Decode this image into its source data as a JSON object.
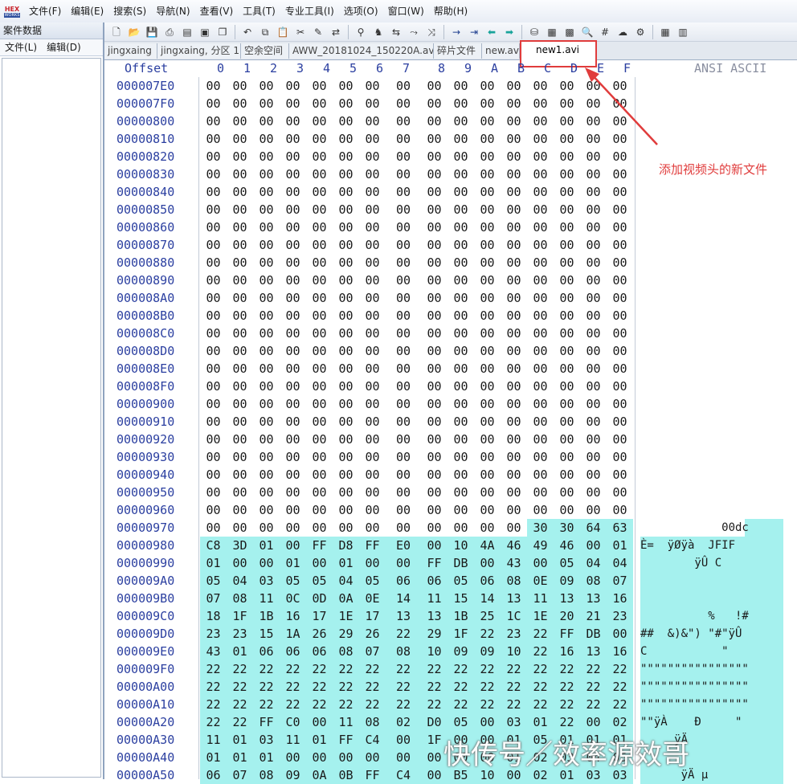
{
  "menu": [
    "文件(F)",
    "编辑(E)",
    "搜索(S)",
    "导航(N)",
    "查看(V)",
    "工具(T)",
    "专业工具(I)",
    "选项(O)",
    "窗口(W)",
    "帮助(H)"
  ],
  "logo_text": [
    "HEX",
    "WORKS"
  ],
  "left_panel": {
    "title": "案件数据",
    "menu": [
      "文件(L)",
      "编辑(D)"
    ]
  },
  "toolbar_icons": [
    [
      "new-file-icon",
      "open-file-icon",
      "save-icon",
      "print-icon",
      "properties-icon",
      "open-disk-icon",
      "clone-icon"
    ],
    [
      "undo-icon",
      "copy-icon",
      "paste-icon",
      "cut-icon",
      "write-icon",
      "convert-icon"
    ],
    [
      "find-icon",
      "find-hex-icon",
      "replace-icon",
      "find-next-icon",
      "replace-hex-icon"
    ],
    [
      "goto-icon",
      "goto-offset-icon",
      "back-arrow-icon",
      "forward-arrow-icon"
    ],
    [
      "disk-icon",
      "ram-icon",
      "calc-icon",
      "zoom-icon",
      "hash-icon",
      "cloud-icon",
      "gear-icon"
    ],
    [
      "tiles-icon",
      "windows-icon"
    ]
  ],
  "tabs": [
    {
      "label": "jingxaing",
      "active": false
    },
    {
      "label": "jingxaing, 分区 1",
      "active": false
    },
    {
      "label": "空余空间",
      "active": false
    },
    {
      "label": "AWW_20181024_150220A.avi",
      "active": false
    },
    {
      "label": "碎片文件",
      "active": false
    },
    {
      "label": "new.avi",
      "active": false
    },
    {
      "label": "new1.avi",
      "active": true
    }
  ],
  "header": {
    "offset_label": "Offset",
    "columns": [
      "0",
      "1",
      "2",
      "3",
      "4",
      "5",
      "6",
      "7",
      "8",
      "9",
      "A",
      "B",
      "C",
      "D",
      "E",
      "F"
    ],
    "ascii_label": "ANSI ASCII"
  },
  "rows": [
    {
      "offset": "000007E0",
      "bytes": [
        "00",
        "00",
        "00",
        "00",
        "00",
        "00",
        "00",
        "00",
        "00",
        "00",
        "00",
        "00",
        "00",
        "00",
        "00",
        "00"
      ],
      "ascii": ""
    },
    {
      "offset": "000007F0",
      "bytes": [
        "00",
        "00",
        "00",
        "00",
        "00",
        "00",
        "00",
        "00",
        "00",
        "00",
        "00",
        "00",
        "00",
        "00",
        "00",
        "00"
      ],
      "ascii": ""
    },
    {
      "offset": "00000800",
      "bytes": [
        "00",
        "00",
        "00",
        "00",
        "00",
        "00",
        "00",
        "00",
        "00",
        "00",
        "00",
        "00",
        "00",
        "00",
        "00",
        "00"
      ],
      "ascii": ""
    },
    {
      "offset": "00000810",
      "bytes": [
        "00",
        "00",
        "00",
        "00",
        "00",
        "00",
        "00",
        "00",
        "00",
        "00",
        "00",
        "00",
        "00",
        "00",
        "00",
        "00"
      ],
      "ascii": ""
    },
    {
      "offset": "00000820",
      "bytes": [
        "00",
        "00",
        "00",
        "00",
        "00",
        "00",
        "00",
        "00",
        "00",
        "00",
        "00",
        "00",
        "00",
        "00",
        "00",
        "00"
      ],
      "ascii": ""
    },
    {
      "offset": "00000830",
      "bytes": [
        "00",
        "00",
        "00",
        "00",
        "00",
        "00",
        "00",
        "00",
        "00",
        "00",
        "00",
        "00",
        "00",
        "00",
        "00",
        "00"
      ],
      "ascii": ""
    },
    {
      "offset": "00000840",
      "bytes": [
        "00",
        "00",
        "00",
        "00",
        "00",
        "00",
        "00",
        "00",
        "00",
        "00",
        "00",
        "00",
        "00",
        "00",
        "00",
        "00"
      ],
      "ascii": ""
    },
    {
      "offset": "00000850",
      "bytes": [
        "00",
        "00",
        "00",
        "00",
        "00",
        "00",
        "00",
        "00",
        "00",
        "00",
        "00",
        "00",
        "00",
        "00",
        "00",
        "00"
      ],
      "ascii": ""
    },
    {
      "offset": "00000860",
      "bytes": [
        "00",
        "00",
        "00",
        "00",
        "00",
        "00",
        "00",
        "00",
        "00",
        "00",
        "00",
        "00",
        "00",
        "00",
        "00",
        "00"
      ],
      "ascii": ""
    },
    {
      "offset": "00000870",
      "bytes": [
        "00",
        "00",
        "00",
        "00",
        "00",
        "00",
        "00",
        "00",
        "00",
        "00",
        "00",
        "00",
        "00",
        "00",
        "00",
        "00"
      ],
      "ascii": ""
    },
    {
      "offset": "00000880",
      "bytes": [
        "00",
        "00",
        "00",
        "00",
        "00",
        "00",
        "00",
        "00",
        "00",
        "00",
        "00",
        "00",
        "00",
        "00",
        "00",
        "00"
      ],
      "ascii": ""
    },
    {
      "offset": "00000890",
      "bytes": [
        "00",
        "00",
        "00",
        "00",
        "00",
        "00",
        "00",
        "00",
        "00",
        "00",
        "00",
        "00",
        "00",
        "00",
        "00",
        "00"
      ],
      "ascii": ""
    },
    {
      "offset": "000008A0",
      "bytes": [
        "00",
        "00",
        "00",
        "00",
        "00",
        "00",
        "00",
        "00",
        "00",
        "00",
        "00",
        "00",
        "00",
        "00",
        "00",
        "00"
      ],
      "ascii": ""
    },
    {
      "offset": "000008B0",
      "bytes": [
        "00",
        "00",
        "00",
        "00",
        "00",
        "00",
        "00",
        "00",
        "00",
        "00",
        "00",
        "00",
        "00",
        "00",
        "00",
        "00"
      ],
      "ascii": ""
    },
    {
      "offset": "000008C0",
      "bytes": [
        "00",
        "00",
        "00",
        "00",
        "00",
        "00",
        "00",
        "00",
        "00",
        "00",
        "00",
        "00",
        "00",
        "00",
        "00",
        "00"
      ],
      "ascii": ""
    },
    {
      "offset": "000008D0",
      "bytes": [
        "00",
        "00",
        "00",
        "00",
        "00",
        "00",
        "00",
        "00",
        "00",
        "00",
        "00",
        "00",
        "00",
        "00",
        "00",
        "00"
      ],
      "ascii": ""
    },
    {
      "offset": "000008E0",
      "bytes": [
        "00",
        "00",
        "00",
        "00",
        "00",
        "00",
        "00",
        "00",
        "00",
        "00",
        "00",
        "00",
        "00",
        "00",
        "00",
        "00"
      ],
      "ascii": ""
    },
    {
      "offset": "000008F0",
      "bytes": [
        "00",
        "00",
        "00",
        "00",
        "00",
        "00",
        "00",
        "00",
        "00",
        "00",
        "00",
        "00",
        "00",
        "00",
        "00",
        "00"
      ],
      "ascii": ""
    },
    {
      "offset": "00000900",
      "bytes": [
        "00",
        "00",
        "00",
        "00",
        "00",
        "00",
        "00",
        "00",
        "00",
        "00",
        "00",
        "00",
        "00",
        "00",
        "00",
        "00"
      ],
      "ascii": ""
    },
    {
      "offset": "00000910",
      "bytes": [
        "00",
        "00",
        "00",
        "00",
        "00",
        "00",
        "00",
        "00",
        "00",
        "00",
        "00",
        "00",
        "00",
        "00",
        "00",
        "00"
      ],
      "ascii": ""
    },
    {
      "offset": "00000920",
      "bytes": [
        "00",
        "00",
        "00",
        "00",
        "00",
        "00",
        "00",
        "00",
        "00",
        "00",
        "00",
        "00",
        "00",
        "00",
        "00",
        "00"
      ],
      "ascii": ""
    },
    {
      "offset": "00000930",
      "bytes": [
        "00",
        "00",
        "00",
        "00",
        "00",
        "00",
        "00",
        "00",
        "00",
        "00",
        "00",
        "00",
        "00",
        "00",
        "00",
        "00"
      ],
      "ascii": ""
    },
    {
      "offset": "00000940",
      "bytes": [
        "00",
        "00",
        "00",
        "00",
        "00",
        "00",
        "00",
        "00",
        "00",
        "00",
        "00",
        "00",
        "00",
        "00",
        "00",
        "00"
      ],
      "ascii": ""
    },
    {
      "offset": "00000950",
      "bytes": [
        "00",
        "00",
        "00",
        "00",
        "00",
        "00",
        "00",
        "00",
        "00",
        "00",
        "00",
        "00",
        "00",
        "00",
        "00",
        "00"
      ],
      "ascii": ""
    },
    {
      "offset": "00000960",
      "bytes": [
        "00",
        "00",
        "00",
        "00",
        "00",
        "00",
        "00",
        "00",
        "00",
        "00",
        "00",
        "00",
        "00",
        "00",
        "00",
        "00"
      ],
      "ascii": ""
    },
    {
      "offset": "00000970",
      "bytes": [
        "00",
        "00",
        "00",
        "00",
        "00",
        "00",
        "00",
        "00",
        "00",
        "00",
        "00",
        "00",
        "30",
        "30",
        "64",
        "63"
      ],
      "ascii": "            00dc",
      "hl_from": 12,
      "ascii_hl": "partial"
    },
    {
      "offset": "00000980",
      "bytes": [
        "C8",
        "3D",
        "01",
        "00",
        "FF",
        "D8",
        "FF",
        "E0",
        "00",
        "10",
        "4A",
        "46",
        "49",
        "46",
        "00",
        "01"
      ],
      "ascii": "È=  ÿØÿà  JFIF",
      "hl_from": 0,
      "ascii_hl": "full"
    },
    {
      "offset": "00000990",
      "bytes": [
        "01",
        "00",
        "00",
        "01",
        "00",
        "01",
        "00",
        "00",
        "FF",
        "DB",
        "00",
        "43",
        "00",
        "05",
        "04",
        "04"
      ],
      "ascii": "        ÿÛ C",
      "hl_from": 0,
      "ascii_hl": "full"
    },
    {
      "offset": "000009A0",
      "bytes": [
        "05",
        "04",
        "03",
        "05",
        "05",
        "04",
        "05",
        "06",
        "06",
        "05",
        "06",
        "08",
        "0E",
        "09",
        "08",
        "07"
      ],
      "ascii": "",
      "hl_from": 0,
      "ascii_hl": "full"
    },
    {
      "offset": "000009B0",
      "bytes": [
        "07",
        "08",
        "11",
        "0C",
        "0D",
        "0A",
        "0E",
        "14",
        "11",
        "15",
        "14",
        "13",
        "11",
        "13",
        "13",
        "16"
      ],
      "ascii": "",
      "hl_from": 0,
      "ascii_hl": "full"
    },
    {
      "offset": "000009C0",
      "bytes": [
        "18",
        "1F",
        "1B",
        "16",
        "17",
        "1E",
        "17",
        "13",
        "13",
        "1B",
        "25",
        "1C",
        "1E",
        "20",
        "21",
        "23"
      ],
      "ascii": "          %   !#",
      "hl_from": 0,
      "ascii_hl": "full"
    },
    {
      "offset": "000009D0",
      "bytes": [
        "23",
        "23",
        "15",
        "1A",
        "26",
        "29",
        "26",
        "22",
        "29",
        "1F",
        "22",
        "23",
        "22",
        "FF",
        "DB",
        "00"
      ],
      "ascii": "##  &)&\") \"#\"ÿÛ",
      "hl_from": 0,
      "ascii_hl": "full"
    },
    {
      "offset": "000009E0",
      "bytes": [
        "43",
        "01",
        "06",
        "06",
        "06",
        "08",
        "07",
        "08",
        "10",
        "09",
        "09",
        "10",
        "22",
        "16",
        "13",
        "16"
      ],
      "ascii": "C           \"",
      "hl_from": 0,
      "ascii_hl": "full"
    },
    {
      "offset": "000009F0",
      "bytes": [
        "22",
        "22",
        "22",
        "22",
        "22",
        "22",
        "22",
        "22",
        "22",
        "22",
        "22",
        "22",
        "22",
        "22",
        "22",
        "22"
      ],
      "ascii": "\"\"\"\"\"\"\"\"\"\"\"\"\"\"\"\"",
      "hl_from": 0,
      "ascii_hl": "full"
    },
    {
      "offset": "00000A00",
      "bytes": [
        "22",
        "22",
        "22",
        "22",
        "22",
        "22",
        "22",
        "22",
        "22",
        "22",
        "22",
        "22",
        "22",
        "22",
        "22",
        "22"
      ],
      "ascii": "\"\"\"\"\"\"\"\"\"\"\"\"\"\"\"\"",
      "hl_from": 0,
      "ascii_hl": "full"
    },
    {
      "offset": "00000A10",
      "bytes": [
        "22",
        "22",
        "22",
        "22",
        "22",
        "22",
        "22",
        "22",
        "22",
        "22",
        "22",
        "22",
        "22",
        "22",
        "22",
        "22"
      ],
      "ascii": "\"\"\"\"\"\"\"\"\"\"\"\"\"\"\"\"",
      "hl_from": 0,
      "ascii_hl": "full"
    },
    {
      "offset": "00000A20",
      "bytes": [
        "22",
        "22",
        "FF",
        "C0",
        "00",
        "11",
        "08",
        "02",
        "D0",
        "05",
        "00",
        "03",
        "01",
        "22",
        "00",
        "02"
      ],
      "ascii": "\"\"ÿÀ    Ð     \"",
      "hl_from": 0,
      "ascii_hl": "full"
    },
    {
      "offset": "00000A30",
      "bytes": [
        "11",
        "01",
        "03",
        "11",
        "01",
        "FF",
        "C4",
        "00",
        "1F",
        "00",
        "00",
        "01",
        "05",
        "01",
        "01",
        "01"
      ],
      "ascii": "     ÿÄ",
      "hl_from": 0,
      "ascii_hl": "full"
    },
    {
      "offset": "00000A40",
      "bytes": [
        "01",
        "01",
        "01",
        "00",
        "00",
        "00",
        "00",
        "00",
        "00",
        "00",
        "00",
        "01",
        "02",
        "03",
        "04",
        "05"
      ],
      "ascii": "",
      "hl_from": 0,
      "ascii_hl": "full"
    },
    {
      "offset": "00000A50",
      "bytes": [
        "06",
        "07",
        "08",
        "09",
        "0A",
        "0B",
        "FF",
        "C4",
        "00",
        "B5",
        "10",
        "00",
        "02",
        "01",
        "03",
        "03"
      ],
      "ascii": "      ÿÄ µ",
      "hl_from": 0,
      "ascii_hl": "full"
    }
  ],
  "annotation": "添加视频头的新文件",
  "watermark": "快传号／效率源效哥",
  "colors": {
    "highlight": "#a5f1ee",
    "offset_text": "#2b3fa0",
    "annotation": "#e03c3c"
  }
}
